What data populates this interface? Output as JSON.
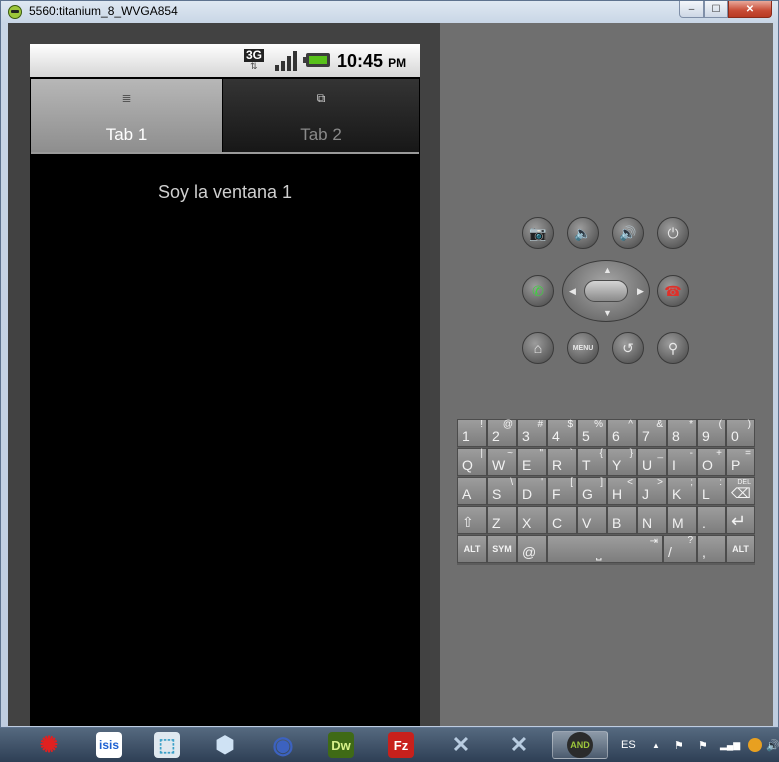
{
  "window": {
    "title": "5560:titanium_8_WVGA854",
    "min_glyph": "–",
    "max_glyph": "☐",
    "close_glyph": "✕"
  },
  "status_bar": {
    "network": "3G",
    "network_arrows": "⇅",
    "time": "10:45",
    "ampm": "PM"
  },
  "tabs": [
    {
      "label": "Tab 1",
      "icon": "≣",
      "selected": true
    },
    {
      "label": "Tab 2",
      "icon": "⧉",
      "selected": false
    }
  ],
  "content": {
    "text": "Soy la ventana 1"
  },
  "controls": {
    "camera": "📷",
    "volume_down": "🔈",
    "volume_up": "🔊",
    "power": "⏻",
    "call": "✆",
    "end_call": "☎",
    "home": "⌂",
    "menu": "MENU",
    "back": "↺",
    "search": "⚲",
    "dpad_up": "▲",
    "dpad_down": "▼",
    "dpad_left": "◀",
    "dpad_right": "▶"
  },
  "keyboard": {
    "row1": [
      {
        "m": "1",
        "s": "!"
      },
      {
        "m": "2",
        "s": "@"
      },
      {
        "m": "3",
        "s": "#"
      },
      {
        "m": "4",
        "s": "$"
      },
      {
        "m": "5",
        "s": "%"
      },
      {
        "m": "6",
        "s": "^"
      },
      {
        "m": "7",
        "s": "&"
      },
      {
        "m": "8",
        "s": "*"
      },
      {
        "m": "9",
        "s": "("
      },
      {
        "m": "0",
        "s": ")"
      }
    ],
    "row2": [
      {
        "m": "Q",
        "s": "|"
      },
      {
        "m": "W",
        "s": "~"
      },
      {
        "m": "E",
        "s": "\""
      },
      {
        "m": "R",
        "s": "`"
      },
      {
        "m": "T",
        "s": "{"
      },
      {
        "m": "Y",
        "s": "}"
      },
      {
        "m": "U",
        "s": "_"
      },
      {
        "m": "I",
        "s": "-"
      },
      {
        "m": "O",
        "s": "+"
      },
      {
        "m": "P",
        "s": "="
      }
    ],
    "row3": [
      {
        "m": "A",
        "s": ""
      },
      {
        "m": "S",
        "s": "\\"
      },
      {
        "m": "D",
        "s": "'"
      },
      {
        "m": "F",
        "s": "["
      },
      {
        "m": "G",
        "s": "]"
      },
      {
        "m": "H",
        "s": "<"
      },
      {
        "m": "J",
        "s": ">"
      },
      {
        "m": "K",
        "s": ";"
      },
      {
        "m": "L",
        "s": ":"
      },
      {
        "m": "⌫",
        "s": "DEL"
      }
    ],
    "row4": [
      {
        "m": "⇧",
        "s": ""
      },
      {
        "m": "Z",
        "s": ""
      },
      {
        "m": "X",
        "s": ""
      },
      {
        "m": "C",
        "s": ""
      },
      {
        "m": "V",
        "s": ""
      },
      {
        "m": "B",
        "s": ""
      },
      {
        "m": "N",
        "s": ""
      },
      {
        "m": "M",
        "s": ""
      },
      {
        "m": ".",
        "s": ""
      },
      {
        "m": "↵",
        "s": ""
      }
    ],
    "alt_left": "ALT",
    "sym": "SYM",
    "at": "@",
    "space": "⎵",
    "space_arrow": "⇥",
    "slash": "/",
    "question": "?",
    "comma": ",",
    "alt_right": "ALT"
  },
  "taskbar": {
    "items": [
      {
        "label": "✺",
        "color": "#e02020"
      },
      {
        "label": "isis",
        "color": "#1d5fd1"
      },
      {
        "label": "⬚",
        "color": "#3aa0c8"
      },
      {
        "label": "⬢",
        "color": "#8db3d8"
      },
      {
        "label": "◉",
        "color": "#2a52a8"
      },
      {
        "label": "Dw",
        "color": "#3f6a16"
      },
      {
        "label": "Fz",
        "color": "#c8201c"
      },
      {
        "label": "✕",
        "color": "#6a8fb8"
      },
      {
        "label": "✕",
        "color": "#6a8fb8"
      },
      {
        "label": "AND",
        "color": "#2b2b2b"
      }
    ],
    "language": "ES",
    "tray_up": "▲",
    "tray_flag": "⚑",
    "tray_signal": "▂▄▆",
    "tray_volume": "🔊"
  }
}
